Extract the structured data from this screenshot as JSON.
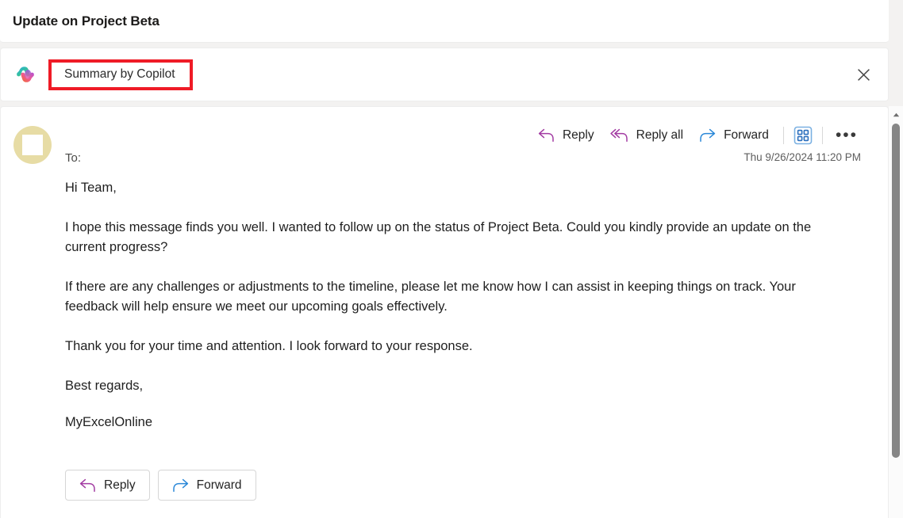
{
  "subject": {
    "title": "Update on Project Beta"
  },
  "copilot_bar": {
    "icon": "copilot-icon",
    "summary_label": "Summary by Copilot",
    "highlight_color": "#ef1b26",
    "close_icon": "close-icon"
  },
  "message": {
    "avatar": "avatar-placeholder",
    "to_label": "To:",
    "to_value": "",
    "timestamp": "Thu 9/26/2024 11:20 PM",
    "actions": [
      {
        "label": "Reply",
        "icon": "reply-arrow-icon",
        "color": "#a23ba2"
      },
      {
        "label": "Reply all",
        "icon": "reply-all-arrow-icon",
        "color": "#a23ba2"
      },
      {
        "label": "Forward",
        "icon": "forward-arrow-icon",
        "color": "#2b88d8"
      }
    ],
    "apps_icon": "apps-grid-icon",
    "more_icon": "ellipsis-icon",
    "more_label": "•••",
    "body": [
      "Hi Team,",
      "I hope this message finds you well. I wanted to follow up on the status of Project Beta. Could you kindly provide an update on the current progress?",
      "If there are any challenges or adjustments to the timeline, please let me know how I can assist in keeping things on track. Your feedback will help ensure we meet our upcoming goals effectively.",
      "Thank you for your time and attention. I look forward to your response.",
      "Best regards,",
      "MyExcelOnline"
    ],
    "footer_buttons": [
      {
        "label": "Reply",
        "icon": "reply-arrow-icon",
        "color": "#a23ba2"
      },
      {
        "label": "Forward",
        "icon": "forward-arrow-icon",
        "color": "#2b88d8"
      }
    ]
  },
  "scrollbar": {
    "up_icon": "scroll-up-arrow-icon",
    "thumb": "scroll-thumb"
  }
}
